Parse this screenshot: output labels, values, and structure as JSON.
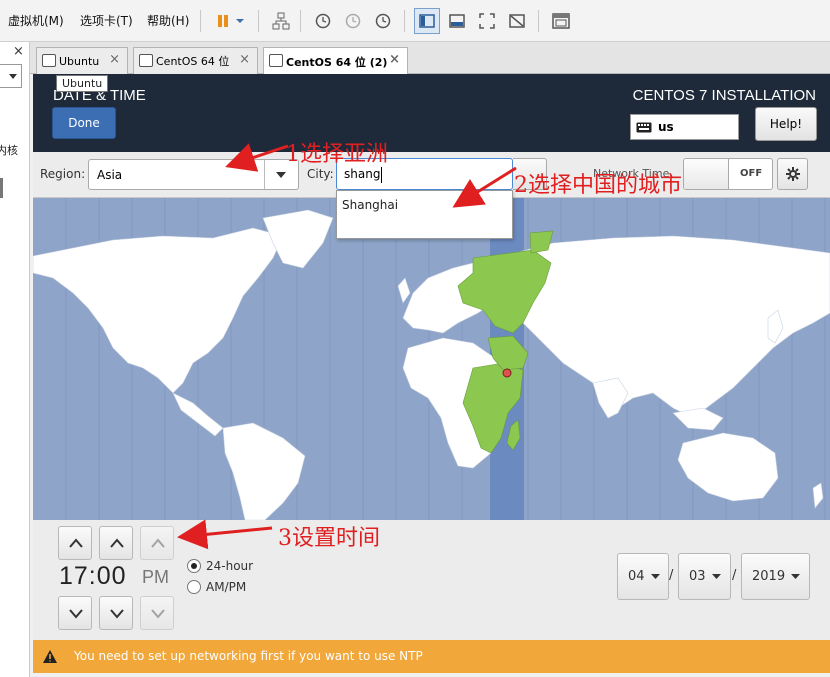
{
  "menubar": {
    "items": [
      "虚拟机(M)",
      "选项卡(T)",
      "帮助(H)"
    ]
  },
  "sidebar": {
    "partial_text": "内核"
  },
  "tabs": [
    {
      "label": "Ubuntu",
      "active": false
    },
    {
      "label": "CentOS 64 位",
      "active": false
    },
    {
      "label": "CentOS 64 位 (2)",
      "active": true
    }
  ],
  "tooltip": "Ubuntu",
  "header": {
    "title": "DATE & TIME",
    "done_label": "Done",
    "installer_title": "CENTOS 7 INSTALLATION",
    "keyboard_layout": "us",
    "help_label": "Help!"
  },
  "options": {
    "region_label": "Region:",
    "region_value": "Asia",
    "city_label": "City:",
    "city_value": "shang",
    "city_suggestion": "Shanghai",
    "network_time_label": "Network Time",
    "network_time_state": "OFF"
  },
  "annotations": {
    "step1": "1选择亚洲",
    "step2": "2选择中国的城市",
    "step3": "3设置时间"
  },
  "time": {
    "value": "17:00",
    "ampm": "PM",
    "format_24": "24-hour",
    "format_ampm": "AM/PM",
    "selected_format": "24-hour"
  },
  "date": {
    "month": "04",
    "day": "03",
    "year": "2019",
    "separator": "/"
  },
  "warning": {
    "text": "You need to set up networking first if you want to use NTP"
  },
  "colors": {
    "header_bg": "#1e2a3a",
    "done_button": "#3c6eb4",
    "map_ocean": "#8ea4c8",
    "highlight_zone": "#6a8ac0",
    "land": "#ffffff",
    "selected_land": "#8cc850",
    "warning_bg": "#f1a73a",
    "annotation_red": "#e02020"
  }
}
